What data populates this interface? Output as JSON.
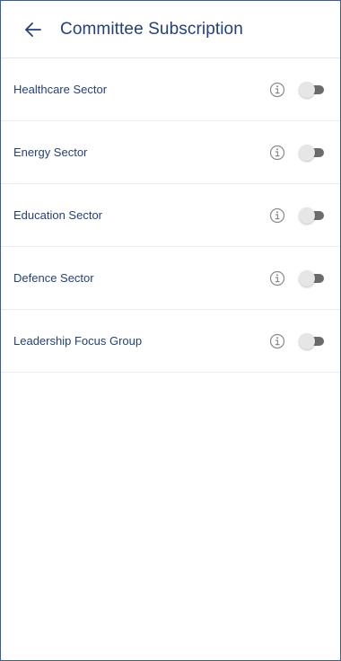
{
  "header": {
    "back_icon": "arrow-left-icon",
    "title": "Committee Subscription"
  },
  "items": [
    {
      "label": "Healthcare Sector",
      "info_icon": "info-icon",
      "subscribed": false
    },
    {
      "label": "Energy Sector",
      "info_icon": "info-icon",
      "subscribed": false
    },
    {
      "label": "Education Sector",
      "info_icon": "info-icon",
      "subscribed": false
    },
    {
      "label": "Defence Sector",
      "info_icon": "info-icon",
      "subscribed": false
    },
    {
      "label": "Leadership Focus Group",
      "info_icon": "info-icon",
      "subscribed": false
    }
  ],
  "colors": {
    "title_text": "#22407e",
    "label_text": "#24417f",
    "frame_border": "#3b5aa0",
    "toggle_track_off": "#6b6b6b",
    "toggle_thumb_off": "#e6e6e6",
    "info_icon": "#8a8a8a"
  }
}
